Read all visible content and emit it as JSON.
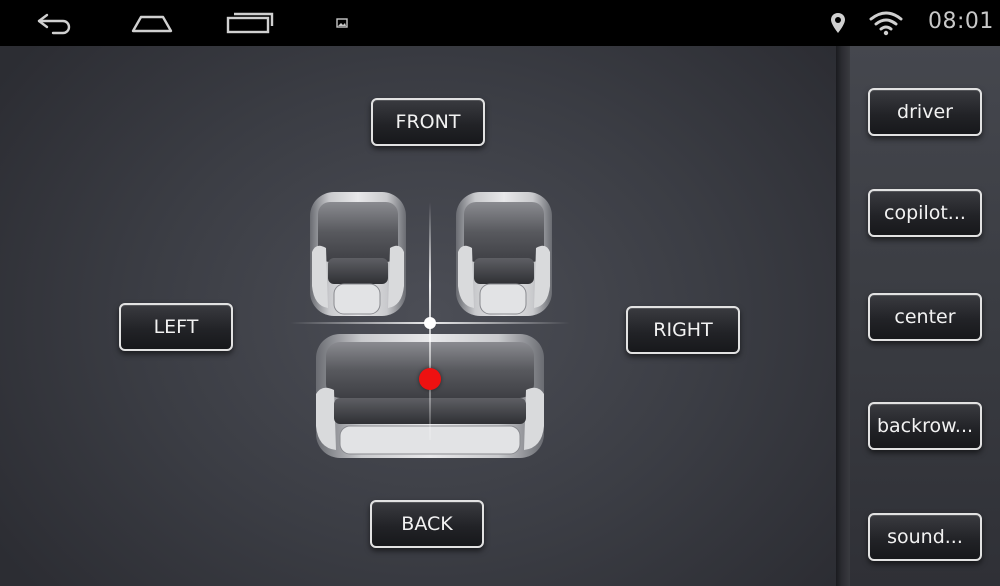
{
  "status_bar": {
    "time": "08:01",
    "icons": [
      "back-icon",
      "home-icon",
      "recent-apps-icon",
      "screenshot-notification-icon",
      "location-icon",
      "wifi-icon"
    ]
  },
  "balance": {
    "front_label": "FRONT",
    "back_label": "BACK",
    "left_label": "LEFT",
    "right_label": "RIGHT",
    "indicator_color": "#ee1111"
  },
  "side_menu": {
    "items": [
      "driver",
      "copilot...",
      "center",
      "backrow...",
      "sound..."
    ]
  }
}
